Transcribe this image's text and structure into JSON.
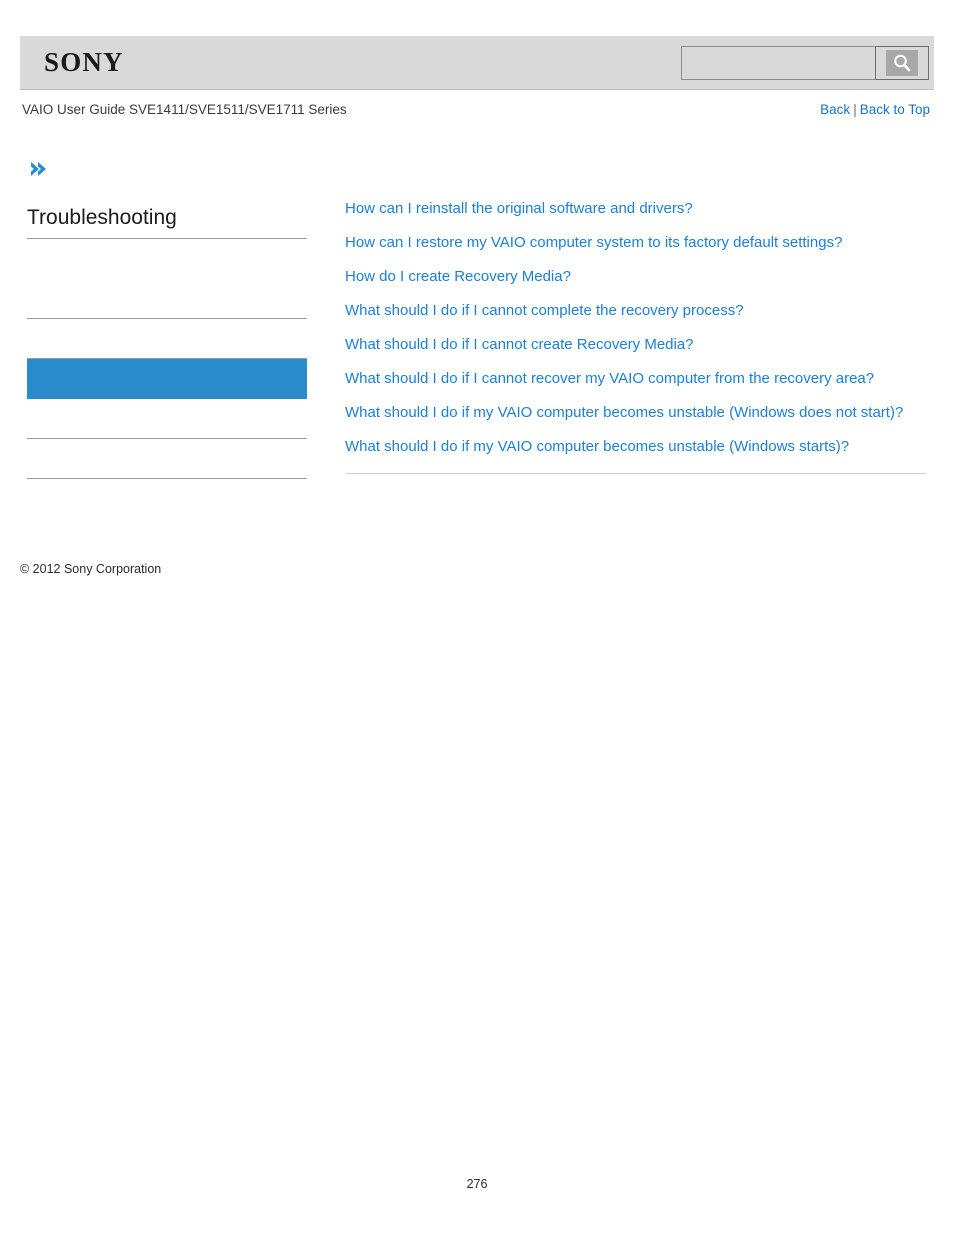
{
  "header": {
    "logo_text": "SONY",
    "logo_icon": "sony-wordmark",
    "search": {
      "value": "",
      "placeholder": "",
      "icon": "search-icon",
      "button_label": ""
    }
  },
  "subheader": {
    "guide_title": "VAIO User Guide SVE1411/SVE1511/SVE1711 Series",
    "nav": {
      "back_label": "Back",
      "separator": "|",
      "back_to_top_label": "Back to Top"
    }
  },
  "sidebar": {
    "chevron_icon": "double-chevron-right-icon",
    "heading": "Troubleshooting",
    "items": [
      {
        "label": "",
        "active": false
      },
      {
        "label": "",
        "active": false
      },
      {
        "label": "",
        "active": false
      },
      {
        "label": "",
        "active": true
      },
      {
        "label": "",
        "active": false
      },
      {
        "label": "",
        "active": false
      }
    ]
  },
  "footer": {
    "copyright": "© 2012 Sony Corporation",
    "page_number": "276"
  },
  "main": {
    "links": [
      "How can I reinstall the original software and drivers?",
      "How can I restore my VAIO computer system to its factory default settings?",
      "How do I create Recovery Media?",
      "What should I do if I cannot complete the recovery process?",
      "What should I do if I cannot create Recovery Media?",
      "What should I do if I cannot recover my VAIO computer from the recovery area?",
      "What should I do if my VAIO computer becomes unstable (Windows does not start)?",
      "What should I do if my VAIO computer becomes unstable (Windows starts)?"
    ]
  },
  "colors": {
    "accent_blue": "#2b8ccc",
    "link_blue": "#1b7fd4",
    "header_grey": "#d9d9d9",
    "rule_grey": "#9a9a9a"
  }
}
